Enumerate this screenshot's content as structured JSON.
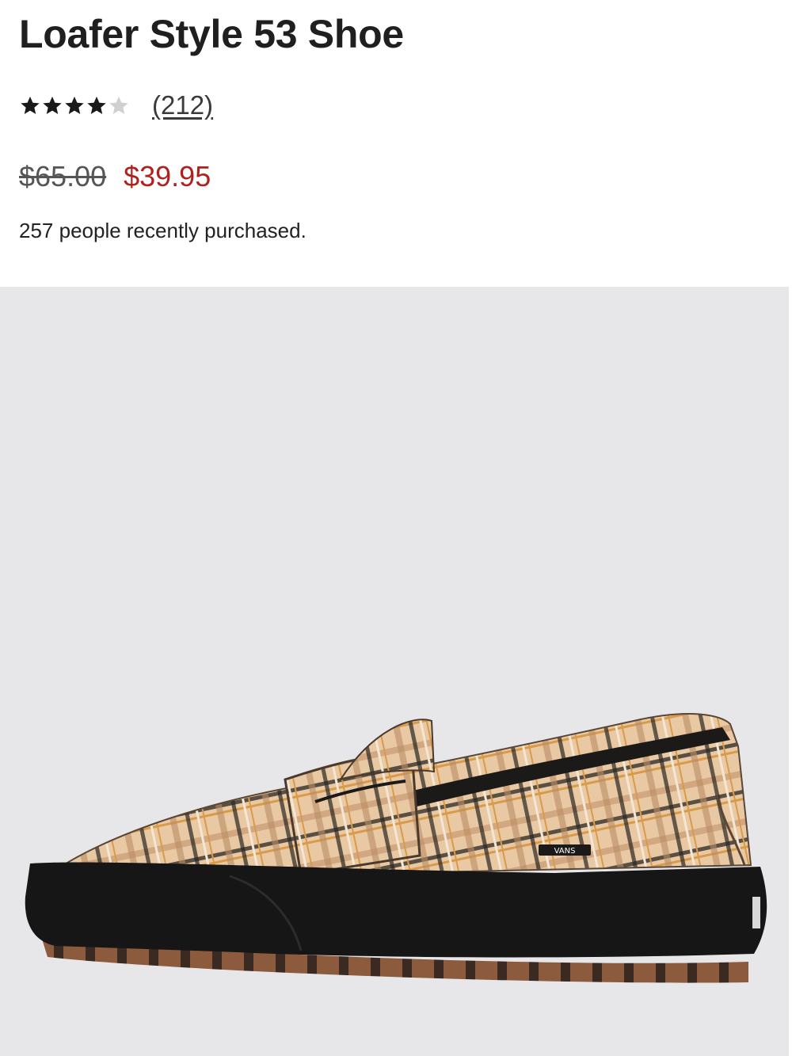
{
  "product": {
    "title": "Loafer Style 53 Shoe",
    "rating": {
      "value": 4,
      "max": 5,
      "review_count_label": "(212)"
    },
    "price": {
      "original": "$65.00",
      "sale": "$39.95"
    },
    "purchased_text": "257 people recently purchased.",
    "image": {
      "brand_tag": "VANS",
      "alt": "Plaid loafer shoe with black sole"
    }
  },
  "colors": {
    "sale": "#b0201c",
    "star_filled": "#1a1a1a",
    "star_empty": "#d0d0d0",
    "image_bg": "#e7e7e9"
  },
  "icons": {
    "star": "star-icon"
  }
}
